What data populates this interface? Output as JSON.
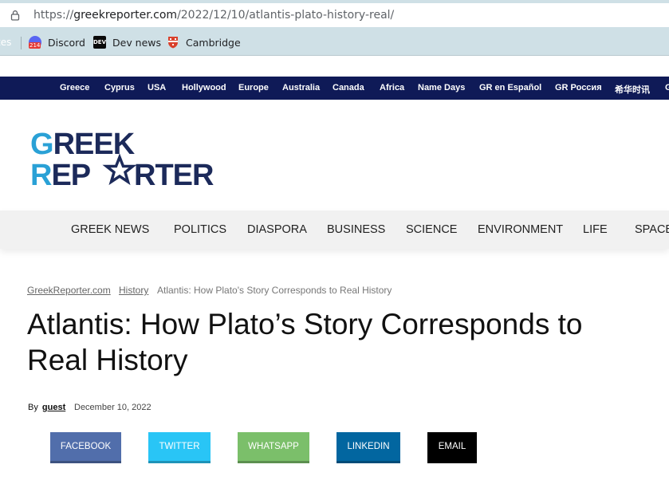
{
  "browser": {
    "url_prefix": "https://",
    "url_domain": "greekreporter.com",
    "url_path": "/2022/12/10/atlantis-plato-history-real/"
  },
  "bookmarks": {
    "faded_label": "tes",
    "items": [
      {
        "label": "Discord",
        "icon": "discord-icon",
        "badge": "214"
      },
      {
        "label": "Dev news",
        "icon": "dev-icon",
        "icon_text": "DEV"
      },
      {
        "label": "Cambridge",
        "icon": "cambridge-shield-icon"
      }
    ]
  },
  "topnav": {
    "items": [
      "Greece",
      "Cyprus",
      "USA",
      "Hollywood",
      "Europe",
      "Australia",
      "Canada",
      "Africa",
      "Name Days",
      "GR en Español",
      "GR Россия",
      "希华时讯",
      "G"
    ]
  },
  "logo": {
    "line1": "GREEK",
    "line2_a": "REP",
    "line2_b": "RTER",
    "colors": {
      "light_blue": "#2aa1d6",
      "navy": "#1c2a5a"
    }
  },
  "mainnav": {
    "items": [
      "GREEK NEWS",
      "POLITICS",
      "DIASPORA",
      "BUSINESS",
      "SCIENCE",
      "ENVIRONMENT",
      "LIFE",
      "SPACE"
    ]
  },
  "breadcrumb": {
    "home": "GreekReporter.com",
    "section": "History",
    "current": "Atlantis: How Plato's Story Corresponds to Real History"
  },
  "article": {
    "title": "Atlantis: How Plato’s Story Corresponds to Real History",
    "by_label": "By",
    "author": "guest",
    "date": "December 10, 2022"
  },
  "share": {
    "buttons": [
      {
        "label": "FACEBOOK",
        "color": "#516eab"
      },
      {
        "label": "TWITTER",
        "color": "#29c5f6"
      },
      {
        "label": "WHATSAPP",
        "color": "#7bbf6a"
      },
      {
        "label": "LINKEDIN",
        "color": "#0266a0"
      },
      {
        "label": "EMAIL",
        "color": "#000000"
      }
    ]
  }
}
